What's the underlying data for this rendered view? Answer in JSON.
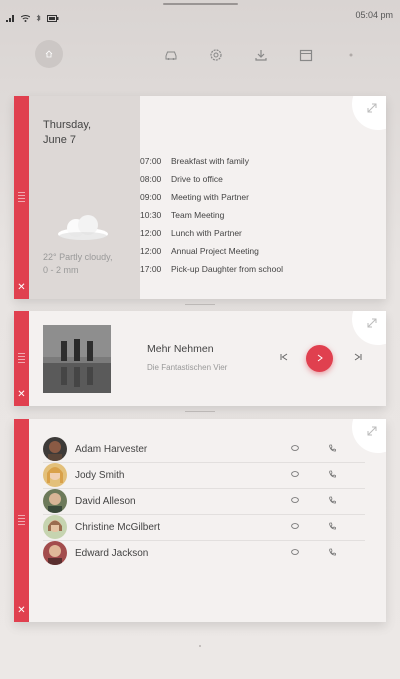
{
  "status": {
    "time": "05:04 pm"
  },
  "calendar": {
    "day": "Thursday,",
    "date": "June 7",
    "weather_line1": "22° Partly cloudy,",
    "weather_line2": "0 - 2 mm",
    "events": [
      {
        "time": "07:00",
        "title": "Breakfast with family"
      },
      {
        "time": "08:00",
        "title": "Drive to office"
      },
      {
        "time": "09:00",
        "title": "Meeting with Partner"
      },
      {
        "time": "10:30",
        "title": "Team Meeting"
      },
      {
        "time": "12:00",
        "title": "Lunch with Partner"
      },
      {
        "time": "12:00",
        "title": "Annual Project Meeting"
      },
      {
        "time": "17:00",
        "title": "Pick-up Daughter from school"
      }
    ]
  },
  "music": {
    "song": "Mehr Nehmen",
    "artist": "Die Fantastischen Vier"
  },
  "contacts": [
    {
      "name": "Adam Harvester",
      "color": "#8a5a44"
    },
    {
      "name": "Jody Smith",
      "color": "#d9a14a"
    },
    {
      "name": "David Alleson",
      "color": "#6d7a5a"
    },
    {
      "name": "Christine McGilbert",
      "color": "#9b6c4f"
    },
    {
      "name": "Edward Jackson",
      "color": "#a34d4d"
    }
  ],
  "colors": {
    "accent": "#e0404f",
    "panel": "#f4f1f0",
    "side_panel": "#ddd8d6"
  },
  "icons": [
    "wifi-icon",
    "signal-icon",
    "bluetooth-icon",
    "battery-icon",
    "home-icon",
    "car-icon",
    "settings-icon",
    "download-icon",
    "calendar-icon",
    "menu-icon",
    "expand-icon",
    "close-icon",
    "cloud-icon",
    "previous-icon",
    "play-icon",
    "next-icon",
    "message-icon",
    "phone-icon"
  ]
}
